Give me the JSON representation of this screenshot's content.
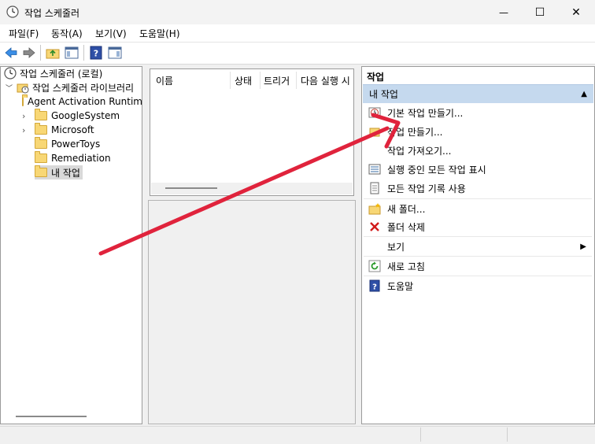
{
  "window": {
    "title": "작업 스케줄러",
    "minimize_glyph": "—",
    "maximize_glyph": "☐",
    "close_glyph": "✕"
  },
  "menu": {
    "items": [
      "파일(F)",
      "동작(A)",
      "보기(V)",
      "도움말(H)"
    ]
  },
  "tree": {
    "root": "작업 스케줄러 (로컬)",
    "library": "작업 스케줄러 라이브러리",
    "children": [
      {
        "label": "Agent Activation Runtime",
        "expandable": false
      },
      {
        "label": "GoogleSystem",
        "expandable": true
      },
      {
        "label": "Microsoft",
        "expandable": true
      },
      {
        "label": "PowerToys",
        "expandable": false
      },
      {
        "label": "Remediation",
        "expandable": false
      },
      {
        "label": "내 작업",
        "expandable": false,
        "selected": true
      }
    ]
  },
  "task_list": {
    "columns": [
      "이름",
      "상태",
      "트리거",
      "다음 실행 시"
    ]
  },
  "actions": {
    "header": "작업",
    "section_title": "내 작업",
    "items": [
      {
        "label": "기본 작업 만들기...",
        "icon": "create-basic-task-icon"
      },
      {
        "label": "작업 만들기...",
        "icon": "create-task-icon"
      },
      {
        "label": "작업 가져오기...",
        "icon": ""
      },
      {
        "label": "실행 중인 모든 작업 표시",
        "icon": "running-tasks-icon"
      },
      {
        "label": "모든 작업 기록 사용",
        "icon": "history-icon"
      },
      {
        "label": "새 폴더...",
        "icon": "new-folder-icon"
      },
      {
        "label": "폴더 삭제",
        "icon": "delete-icon"
      },
      {
        "label": "보기",
        "icon": "",
        "submenu": true
      },
      {
        "label": "새로 고침",
        "icon": "refresh-icon"
      },
      {
        "label": "도움말",
        "icon": "help-icon"
      }
    ]
  },
  "colors": {
    "accent_header": "#c5d9ee",
    "annotation_arrow": "#e0233c",
    "delete_red": "#d11b1b",
    "help_blue": "#2e4fa6"
  }
}
